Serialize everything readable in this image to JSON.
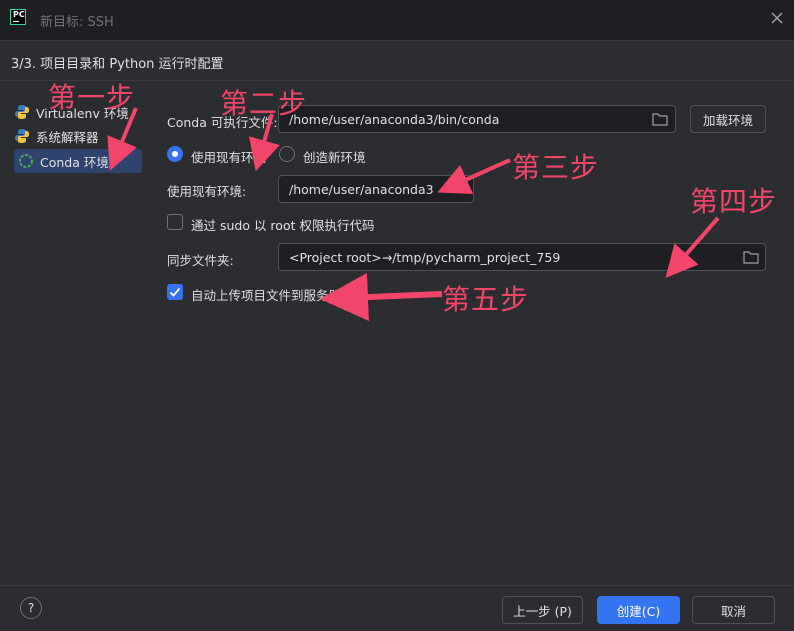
{
  "window": {
    "title": "新目标: SSH",
    "step_title": "3/3. 项目目录和 Python 运行时配置"
  },
  "sidebar": {
    "items": [
      {
        "label": "Virtualenv 环境",
        "icon": "python-icon"
      },
      {
        "label": "系统解释器",
        "icon": "python-icon"
      },
      {
        "label": "Conda 环境",
        "icon": "conda-icon",
        "selected": true
      }
    ]
  },
  "form": {
    "conda_exec_label": "Conda 可执行文件:",
    "conda_exec_value": "/home/user/anaconda3/bin/conda",
    "load_env_button": "加载环境",
    "use_existing_label": "使用现有环境",
    "create_new_label": "创造新环境",
    "existing_env_label": "使用现有环境:",
    "existing_env_value": "/home/user/anaconda3",
    "sudo_label": "通过 sudo 以 root 权限执行代码",
    "sync_label": "同步文件夹:",
    "sync_value": "<Project root>→/tmp/pycharm_project_759",
    "auto_upload_label": "自动上传项目文件到服务器"
  },
  "state": {
    "use_existing_selected": true,
    "sudo_checked": false,
    "auto_upload_checked": true
  },
  "annotations": {
    "step1": "第一步",
    "step2": "第二步",
    "step3": "第三步",
    "step4": "第四步",
    "step5": "第五步"
  },
  "footer": {
    "help": "?",
    "prev_button": "上一步 (P)",
    "create_button": "创建(C)",
    "cancel_button": "取消"
  },
  "colors": {
    "accent": "#3574f0",
    "annotation": "#f2456a",
    "background": "#2b2d30"
  }
}
